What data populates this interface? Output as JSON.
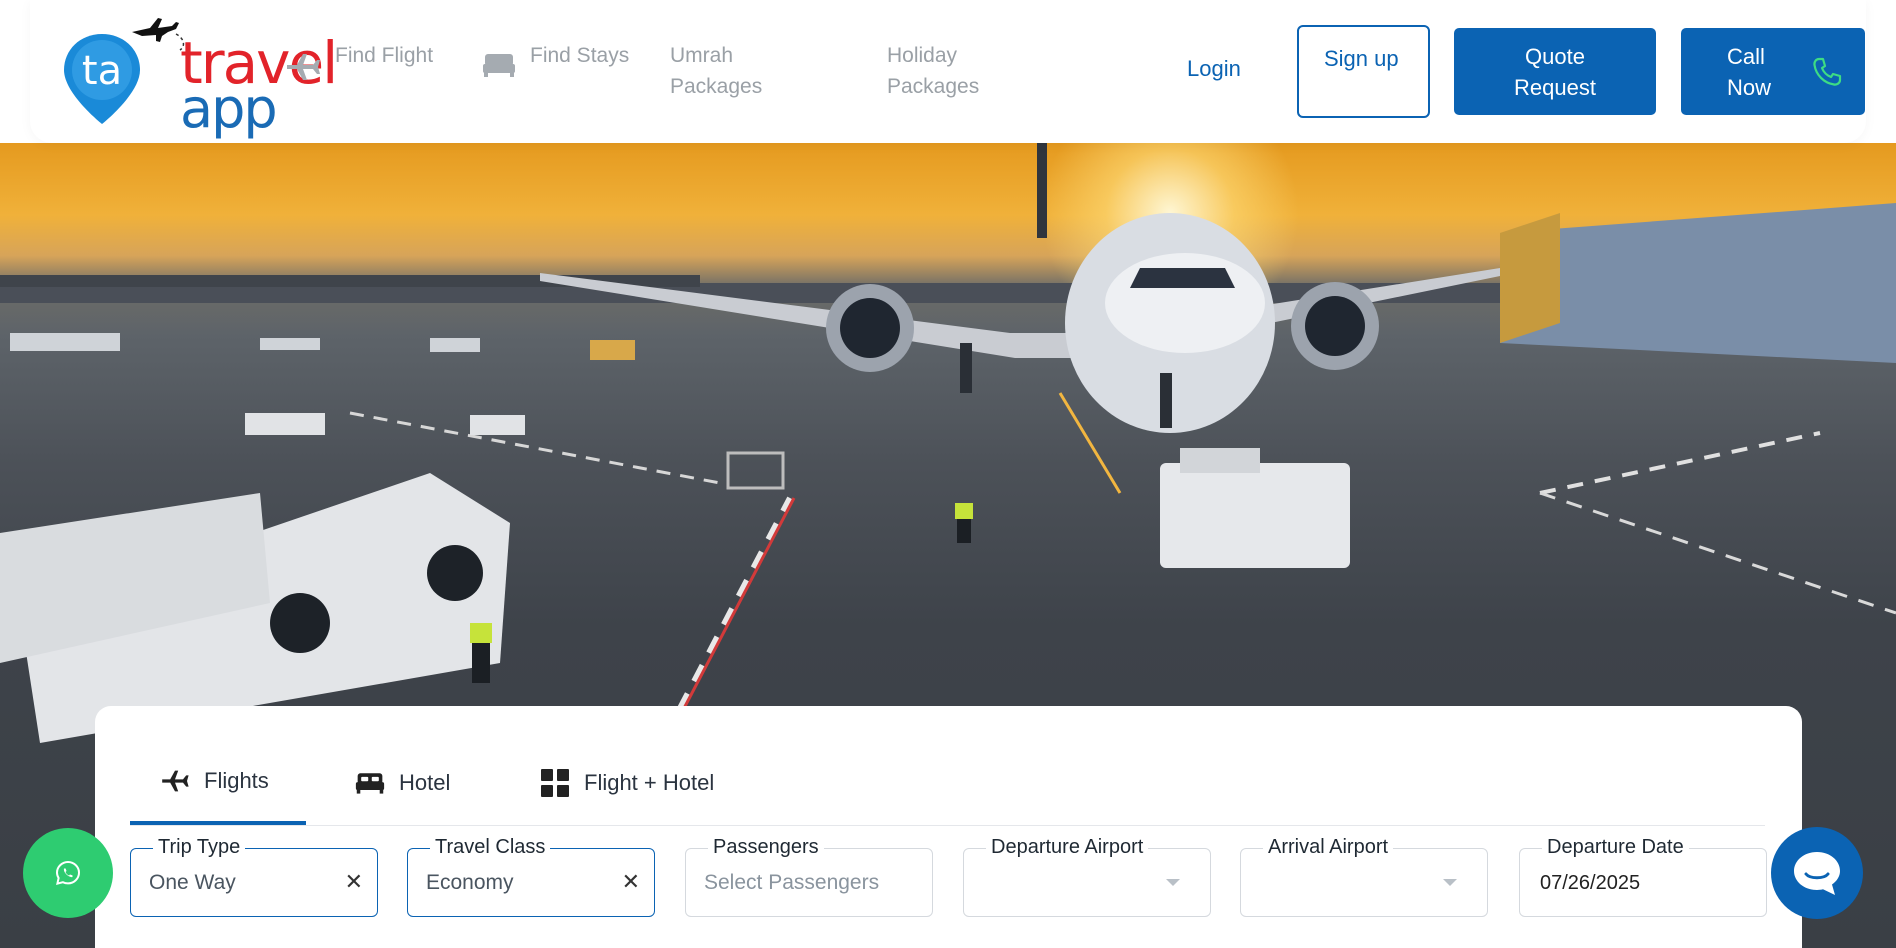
{
  "brand": {
    "logo_mark": "ta",
    "word1": "travel",
    "word2": "app"
  },
  "nav": [
    {
      "label": "Find Flight",
      "icon": "plane-icon"
    },
    {
      "label": "Find Stays",
      "icon": "bed-icon"
    },
    {
      "label": "Umrah Packages"
    },
    {
      "label": "Holiday Packages"
    }
  ],
  "header_actions": {
    "login": "Login",
    "signup": "Sign up",
    "quote": "Quote Request",
    "call": "Call Now",
    "call_icon": "phone-icon"
  },
  "colors": {
    "primary": "#0b63b3",
    "brand_red": "#e2232a",
    "whatsapp": "#2ecc71"
  },
  "search": {
    "tabs": [
      {
        "label": "Flights",
        "icon": "plane-icon",
        "active": true
      },
      {
        "label": "Hotel",
        "icon": "bed-icon",
        "active": false
      },
      {
        "label": "Flight + Hotel",
        "icon": "grid-icon",
        "active": false
      }
    ],
    "fields": {
      "trip_type": {
        "label": "Trip Type",
        "value": "One Way"
      },
      "travel_class": {
        "label": "Travel Class",
        "value": "Economy"
      },
      "passengers": {
        "label": "Passengers",
        "placeholder": "Select Passengers"
      },
      "departure_airport": {
        "label": "Departure Airport",
        "value": ""
      },
      "arrival_airport": {
        "label": "Arrival Airport",
        "value": ""
      },
      "departure_date": {
        "label": "Departure Date",
        "value": "07/26/2025"
      }
    }
  },
  "floating": {
    "whatsapp_icon": "whatsapp-icon",
    "chat_icon": "chat-icon"
  }
}
